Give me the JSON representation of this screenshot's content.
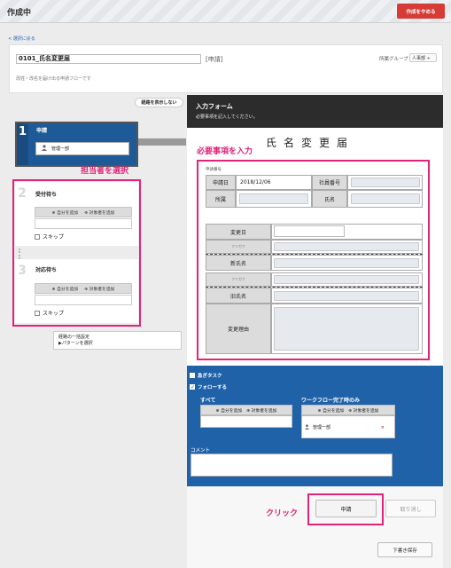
{
  "app": {
    "title": "作成中",
    "cancel_label": "作成をやめる"
  },
  "header": {
    "back_link": "< 選択に戻る",
    "form_name": "0101_氏名変更届",
    "form_tag": "[申請]",
    "group_label": "所属グループ",
    "group_value": "人事部 ÷",
    "description": "改姓・改名を届け出る申請フローです"
  },
  "workflow": {
    "hide_route_label": "経路を表示しない",
    "steps": [
      {
        "num": "1",
        "title": "申請",
        "assignee": "管理一部"
      },
      {
        "num": "2",
        "title": "受付待ち",
        "add_self": "自分を追加",
        "add_target": "対象者を追加",
        "skip": "スキップ"
      },
      {
        "num": "3",
        "title": "対応待ち",
        "add_self": "自分を追加",
        "add_target": "対象者を追加",
        "skip": "スキップ"
      }
    ],
    "annotation": "担当者を選択",
    "bulk_line1": "経路の一括設定",
    "bulk_line2": "▶パターンを選択"
  },
  "form": {
    "header_title": "入力フォーム",
    "header_sub": "必要事項を記入してください。",
    "doc_title": "氏名変更届",
    "annotation": "必要事項を入力",
    "appno_label": "申請番号",
    "date_label": "申請日",
    "date_value": "2018/12/06",
    "empno_label": "社員番号",
    "dept_label": "所属",
    "name_label": "氏名",
    "change_date_label": "変更日",
    "furigana_label": "フリガナ",
    "new_name_label": "新氏名",
    "old_name_label": "旧氏名",
    "reason_label": "変更理由"
  },
  "options": {
    "urgent": "急ぎタスク",
    "follow": "フォローする",
    "all_label": "すべて",
    "on_complete_label": "ワークフロー完了時のみ",
    "add_self": "自分を追加",
    "add_target": "対象者を追加",
    "follower": "管理一部",
    "remove_icon": "×",
    "comment_label": "コメント"
  },
  "actions": {
    "click_annotation": "クリック",
    "apply": "申請",
    "withdraw": "取り消し",
    "draft_save": "下書き保存"
  }
}
